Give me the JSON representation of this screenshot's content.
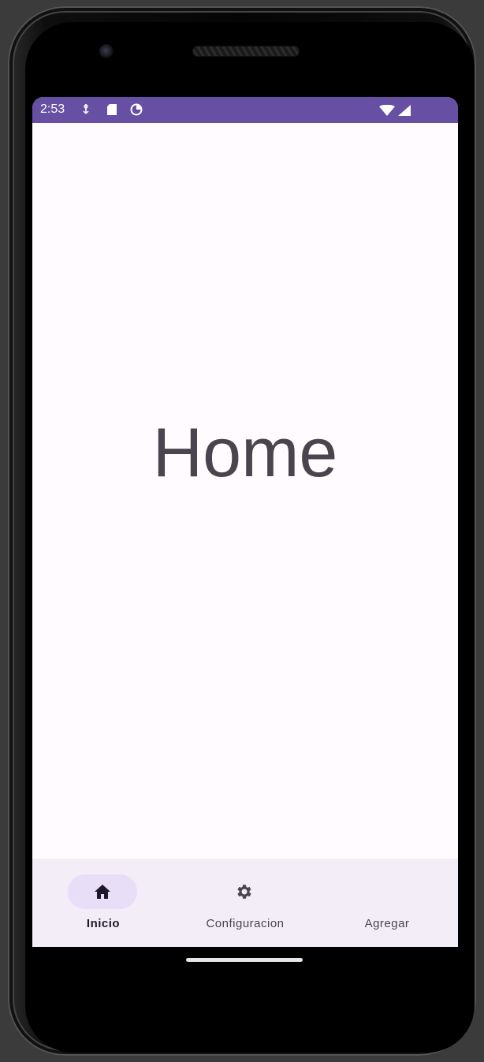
{
  "status_bar": {
    "time": "2:53",
    "background_color": "#6750a4",
    "left_icons": [
      "usb-debug-icon",
      "sd-card-icon",
      "sync-icon"
    ],
    "right_icons": [
      "wifi-icon",
      "signal-icon"
    ]
  },
  "main": {
    "title": "Home"
  },
  "bottom_nav": {
    "background_color": "#f3edf7",
    "active_indicator_color": "#e8def8",
    "items": [
      {
        "label": "Inicio",
        "icon": "home-icon",
        "active": true
      },
      {
        "label": "Configuracion",
        "icon": "gear-icon",
        "active": false
      },
      {
        "label": "Agregar",
        "icon": "",
        "active": false
      }
    ]
  }
}
